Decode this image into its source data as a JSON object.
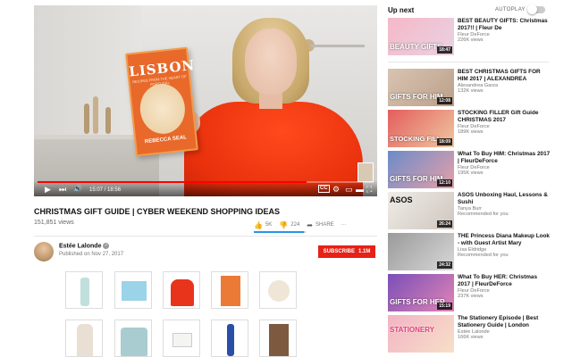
{
  "player": {
    "book_title": "LISBON",
    "book_subtitle": "RECIPES FROM THE HEART OF PORTUGAL",
    "book_author": "REBECCA SEAL",
    "time_current": "15:07",
    "time_total": "18:56",
    "time_sep": " / ",
    "progress": 0.8
  },
  "video": {
    "title": "CHRISTMAS GIFT GUIDE | CYBER WEEKEND SHOPPING IDEAS",
    "views": "151,851 views",
    "likes": "5K",
    "dislikes": "224",
    "share": "SHARE",
    "more": "···",
    "like_ratio": 0.96
  },
  "channel": {
    "name": "Estée Lalonde",
    "verified_mark": "✓",
    "published": "Published on Nov 27, 2017",
    "subscribe_label": "SUBSCRIBE",
    "subscriber_count": "1.1M"
  },
  "sidebar": {
    "up_next": "Up next",
    "autoplay": "AUTOPLAY",
    "items": [
      {
        "title": "BEST BEAUTY GIFTS: Christmas 2017!! | Fleur De",
        "channel": "Fleur DeForce",
        "views": "226K views",
        "duration": "18:47",
        "thumb_text": "BEAUTY GIFTS"
      },
      {
        "title": "BEST CHRISTMAS GIFTS FOR HIM 2017 | ALEXANDREA",
        "channel": "Alexandrea Garza",
        "views": "132K views",
        "duration": "12:08",
        "thumb_text": "GIFTS FOR HIM"
      },
      {
        "title": "STOCKING FILLER Gift Guide CHRISTMAS 2017",
        "channel": "Fleur DeForce",
        "views": "189K views",
        "duration": "18:09",
        "thumb_text": "STOCKING FILL"
      },
      {
        "title": "What To Buy HIM: Christmas 2017 | FleurDeForce",
        "channel": "Fleur DeForce",
        "views": "195K views",
        "duration": "12:10",
        "thumb_text": "GIFTS FOR HIM"
      },
      {
        "title": "ASOS Unboxing Haul, Lessons & Sushi",
        "channel": "Tanya Burr",
        "views": "Recommended for you",
        "duration": "26:24",
        "thumb_text": "ASOS"
      },
      {
        "title": "THE Princess Diana Makeup Look - with Guest Artist Mary",
        "channel": "Lisa Eldridge",
        "views": "Recommended for you",
        "duration": "24:32",
        "thumb_text": ""
      },
      {
        "title": "What To Buy HER: Christmas 2017 | FleurDeForce",
        "channel": "Fleur DeForce",
        "views": "237K views",
        "duration": "15:19",
        "thumb_text": "GIFTS FOR HER"
      },
      {
        "title": "The Stationery Episode | Best Stationery Guide | London",
        "channel": "Estée Lalonde",
        "views": "166K views",
        "duration": "",
        "thumb_text": "STATIONERY"
      }
    ]
  },
  "products": [
    {
      "name": "serum-bottle-product"
    },
    {
      "name": "notebook-product"
    },
    {
      "name": "red-sweater-product"
    },
    {
      "name": "lisbon-book-product"
    },
    {
      "name": "ceramic-dish-product"
    },
    {
      "name": "dress-product"
    },
    {
      "name": "blanket-product"
    },
    {
      "name": "soap-box-product"
    },
    {
      "name": "trimmer-product"
    },
    {
      "name": "coffee-book-product"
    }
  ],
  "colors": {
    "accent_red": "#e62117",
    "progress_red": "#ff0000",
    "like_blue": "#2793e6"
  },
  "icons": {
    "play": "▶",
    "next": "⏭",
    "volume": "🔊",
    "like": "👍",
    "dislike": "👎",
    "share": "➦",
    "cc": "CC",
    "settings": "⚙",
    "miniplayer": "▭",
    "theater": "▬",
    "fullscreen": "⛶"
  }
}
